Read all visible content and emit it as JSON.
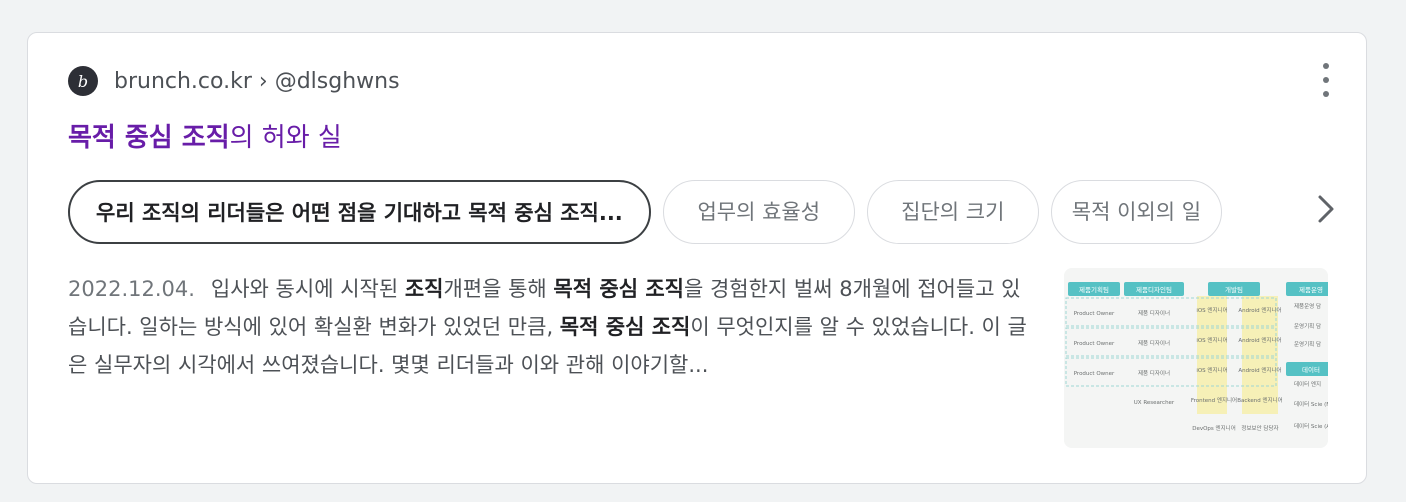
{
  "result": {
    "favicon_letter": "b",
    "source_site": "brunch.co.kr",
    "breadcrumb_separator": "›",
    "source_author": "@dlsghwns",
    "title_bold": "목적 중심 조직",
    "title_rest": "의 허와 실",
    "chips": [
      "우리 조직의 리더들은 어떤 점을 기대하고 목적 중심 조직...",
      "업무의 효율성",
      "집단의 크기",
      "목적 이외의 일"
    ],
    "snippet": {
      "date": "2022.12.04.",
      "parts": [
        {
          "text": "입사와 동시에 시작된 ",
          "bold": false
        },
        {
          "text": "조직",
          "bold": true
        },
        {
          "text": "개편을 통해 ",
          "bold": false
        },
        {
          "text": "목적 중심 조직",
          "bold": true
        },
        {
          "text": "을 경험한지 벌써 8개월에 접어들고 있습니다. 일하는 방식에 있어 확실환 변화가 있었던 만큼, ",
          "bold": false
        },
        {
          "text": "목적 중심 조직",
          "bold": true
        },
        {
          "text": "이 무엇인지를 알 수 있었습니다. 이 글은 실무자의 시각에서 쓰여졌습니다. 몇몇 리더들과 이와 관해 이야기할...",
          "bold": false
        }
      ]
    },
    "thumbnail": {
      "teams": [
        "제품기획팀",
        "제품디자인팀",
        "개발팀",
        "제품운영"
      ],
      "roles": [
        "Product Owner",
        "Product Owner",
        "Product Owner"
      ],
      "design_cell": "제품 디자이너",
      "ux": "UX Researcher",
      "ios": "iOS 엔지니어",
      "android": "Android 엔지니어",
      "frontend": "Frontend 엔지니어",
      "backend": "Backend 엔지니어",
      "devops": "DevOps 엔지니어",
      "security": "정보보안 담당자",
      "ops_items": [
        "제품운영 담",
        "운영기획 담",
        "운영기획 담"
      ],
      "data_team": "데이터",
      "data_items": [
        "데이터 엔지",
        "데이터 Scie (ML/AI)",
        "데이터 Scie (Analytic"
      ]
    }
  },
  "colors": {
    "title": "#681da8",
    "text": "#4d5156",
    "teal": "#55c1c4",
    "highlight": "#f6efa7"
  }
}
